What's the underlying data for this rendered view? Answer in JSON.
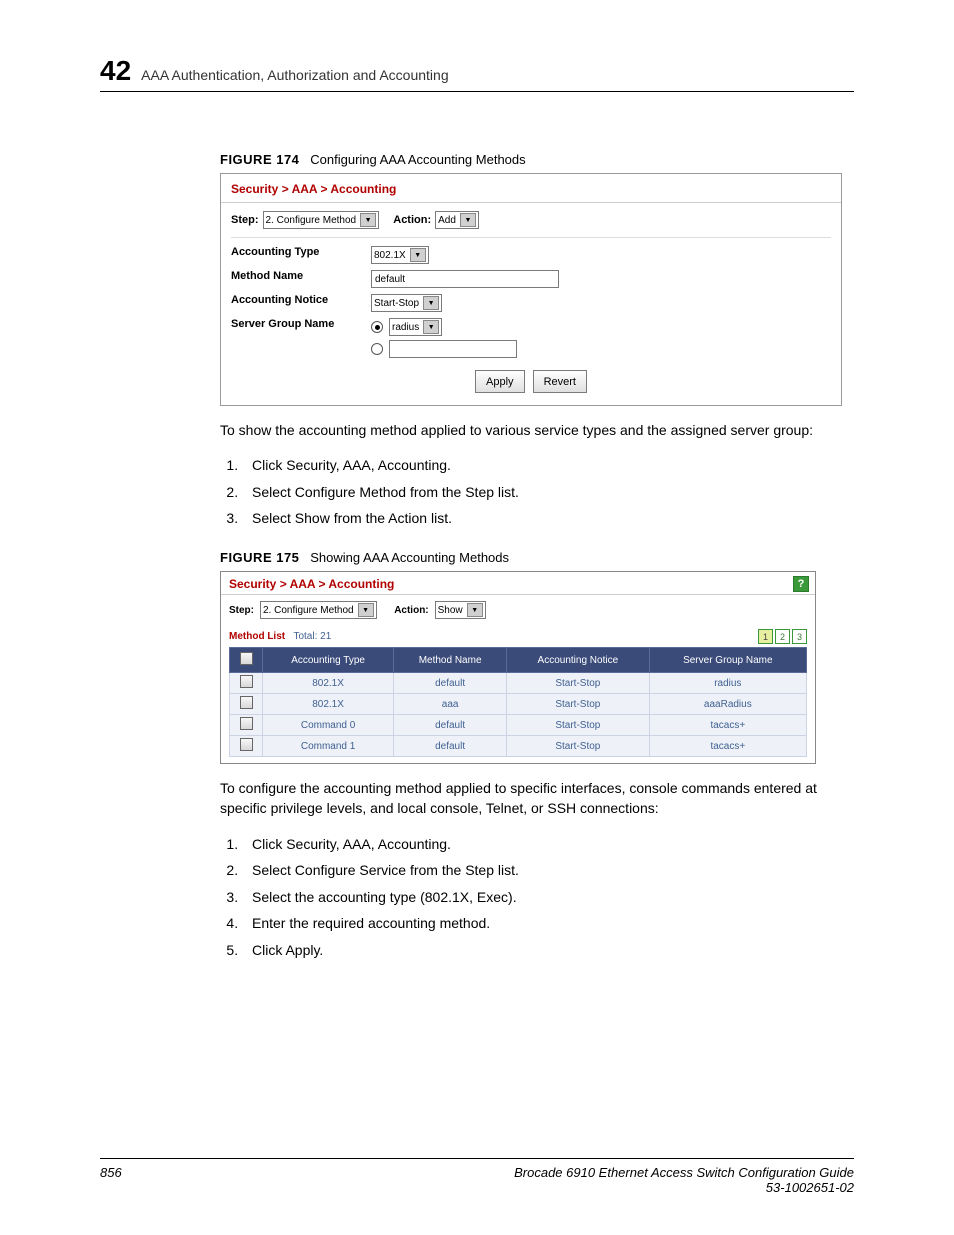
{
  "header": {
    "page_chapter_num": "42",
    "chapter_title": "AAA Authentication, Authorization and Accounting"
  },
  "figure174": {
    "label": "FIGURE 174",
    "caption": "Configuring AAA Accounting Methods",
    "breadcrumb": "Security > AAA > Accounting",
    "step_label": "Step:",
    "step_value": "2. Configure Method",
    "action_label": "Action:",
    "action_value": "Add",
    "rows": {
      "accounting_type": {
        "label": "Accounting Type",
        "value": "802.1X"
      },
      "method_name": {
        "label": "Method Name",
        "value": "default"
      },
      "accounting_notice": {
        "label": "Accounting Notice",
        "value": "Start-Stop"
      },
      "server_group_name": {
        "label": "Server Group Name",
        "value": "radius"
      }
    },
    "buttons": {
      "apply": "Apply",
      "revert": "Revert"
    }
  },
  "intro_text_1": "To show the accounting method applied to various service types and the assigned server group:",
  "steps_1": [
    "Click Security, AAA, Accounting.",
    "Select Configure Method from the Step list.",
    "Select Show from the Action list."
  ],
  "figure175": {
    "label": "FIGURE 175",
    "caption": "Showing AAA Accounting Methods",
    "breadcrumb": "Security > AAA > Accounting",
    "help": "?",
    "step_label": "Step:",
    "step_value": "2. Configure Method",
    "action_label": "Action:",
    "action_value": "Show",
    "method_list_label": "Method List",
    "total_label": "Total: 21",
    "pages": [
      "1",
      "2",
      "3"
    ],
    "columns": [
      "Accounting Type",
      "Method Name",
      "Accounting Notice",
      "Server Group Name"
    ],
    "rows": [
      [
        "802.1X",
        "default",
        "Start-Stop",
        "radius"
      ],
      [
        "802.1X",
        "aaa",
        "Start-Stop",
        "aaaRadius"
      ],
      [
        "Command 0",
        "default",
        "Start-Stop",
        "tacacs+"
      ],
      [
        "Command 1",
        "default",
        "Start-Stop",
        "tacacs+"
      ]
    ]
  },
  "intro_text_2": "To configure the accounting method applied to specific interfaces, console commands entered at specific privilege levels, and local console, Telnet, or SSH connections:",
  "steps_2": [
    "Click Security, AAA, Accounting.",
    "Select Configure Service from the Step list.",
    "Select the accounting type (802.1X, Exec).",
    "Enter the required accounting method.",
    "Click Apply."
  ],
  "footer": {
    "page_num": "856",
    "doc_title": "Brocade 6910 Ethernet Access Switch Configuration Guide",
    "doc_id": "53-1002651-02"
  }
}
